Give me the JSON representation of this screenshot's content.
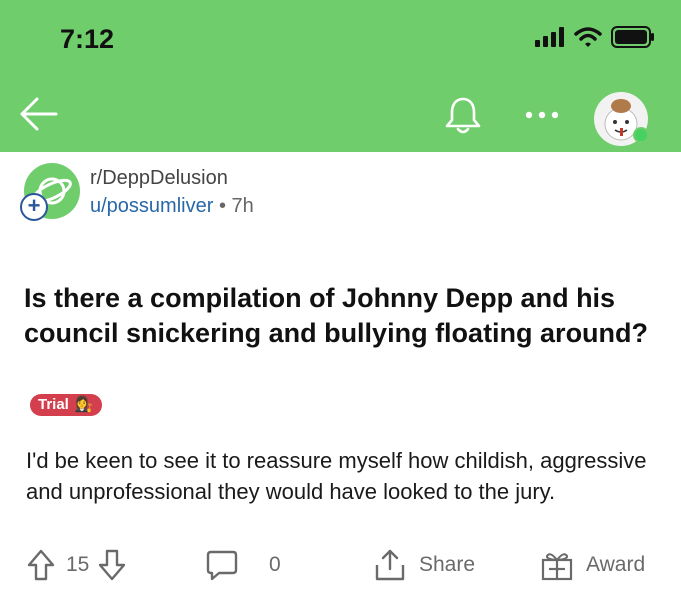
{
  "status_bar": {
    "time": "7:12",
    "icons": [
      "signal-icon",
      "wifi-icon",
      "battery-icon"
    ]
  },
  "nav": {
    "back_icon": "arrow-left-icon",
    "bell_icon": "bell-icon",
    "more_icon": "more-horizontal-icon",
    "avatar_icon": "user-avatar"
  },
  "post": {
    "subreddit": "r/DeppDelusion",
    "author": "u/possumliver",
    "separator": "•",
    "age": "7h",
    "title": "Is there a compilation of Johnny Depp and his council snickering and bullying floating around?",
    "flair": {
      "label": "Trial",
      "emoji": "👩‍⚖️",
      "color": "#d43f4e"
    },
    "body": "I'd be keen to see it to reassure myself how childish, aggressive and unprofessional they would have looked to the jury."
  },
  "actions": {
    "score": "15",
    "comments": "0",
    "share_label": "Share",
    "award_label": "Award"
  },
  "colors": {
    "header_bg": "#6fcd6c",
    "link": "#2868a8",
    "text": "#1a1a1b",
    "muted": "#6a6a6a"
  }
}
